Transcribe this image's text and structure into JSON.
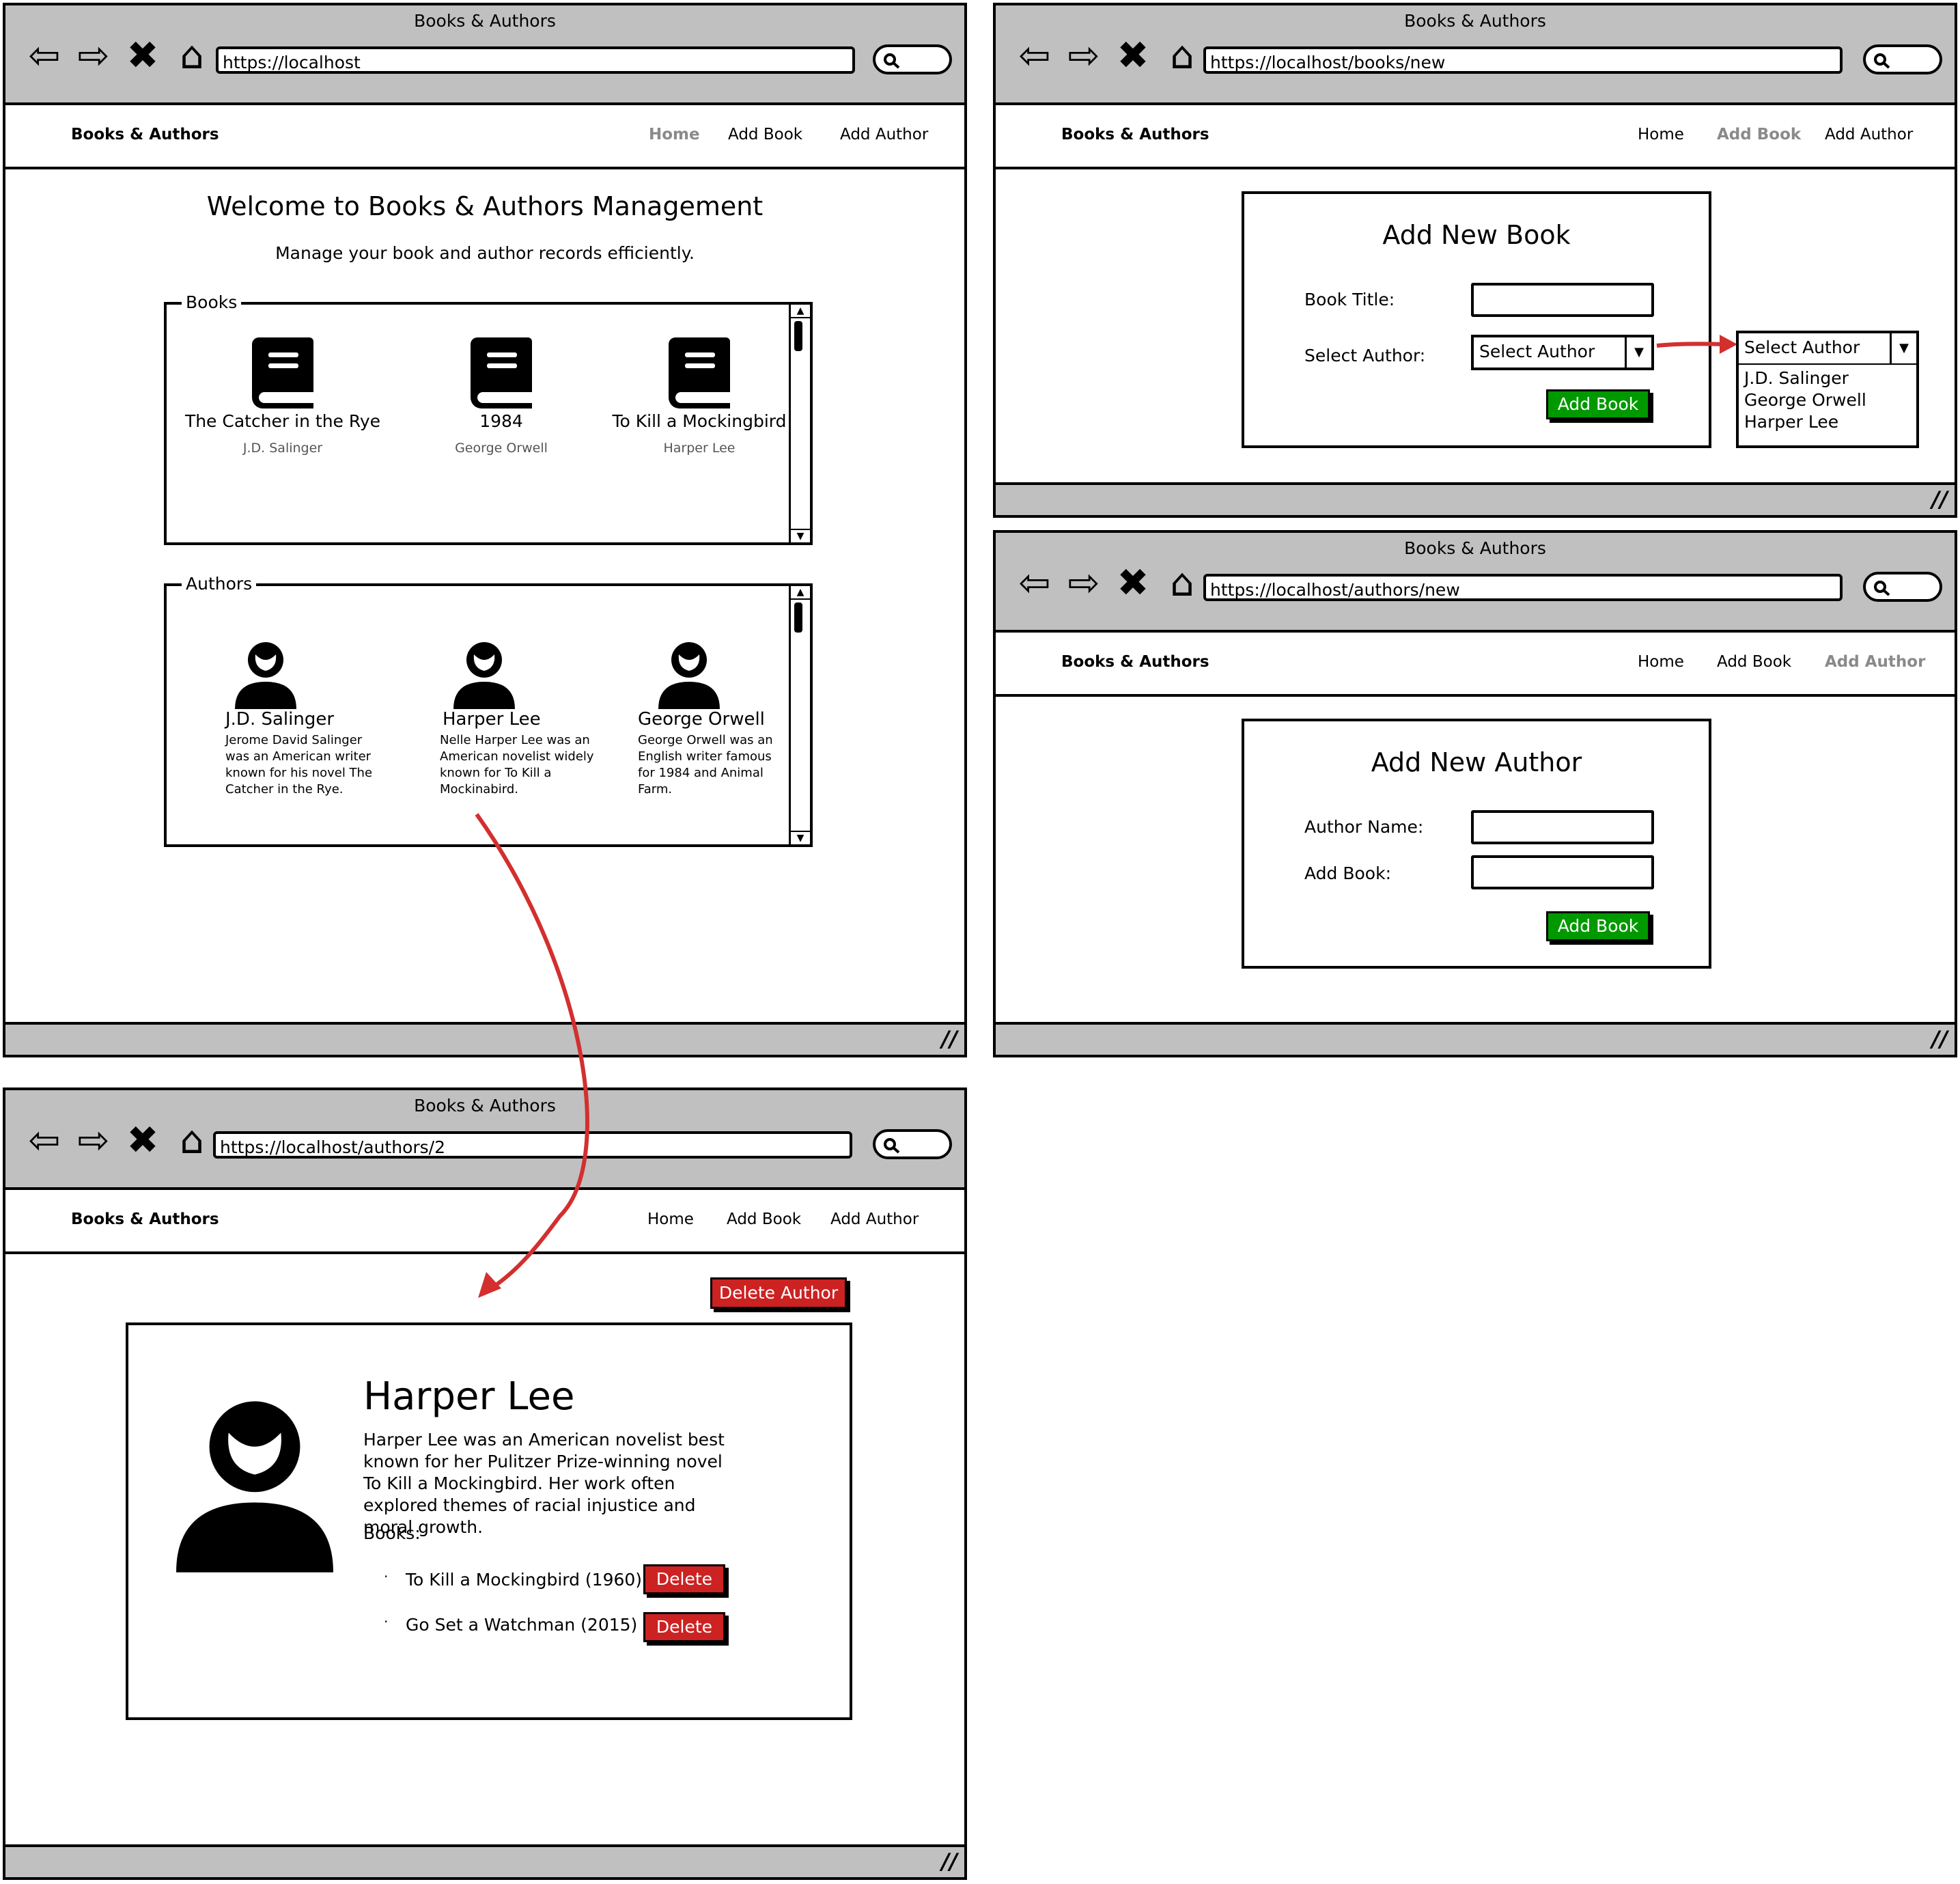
{
  "colors": {
    "chrome": "#c0c0c0",
    "accent_red": "#cc2222",
    "button_green": "#009900",
    "arrow_red": "#d32f2f"
  },
  "common": {
    "window_title": "Books & Authors",
    "brand": "Books & Authors",
    "nav": {
      "home": "Home",
      "add_book": "Add Book",
      "add_author": "Add Author"
    },
    "nav_icons": [
      "back-arrow-icon",
      "forward-arrow-icon",
      "close-icon",
      "home-icon"
    ],
    "search_icon": "search-icon"
  },
  "home": {
    "url": "https://localhost",
    "active_nav": "Home",
    "heading": "Welcome to Books & Authors Management",
    "subheading": "Manage your book and author records efficiently.",
    "books_label": "Books",
    "books": [
      {
        "title": "The Catcher in the Rye",
        "author": "J.D. Salinger",
        "icon": "book-icon"
      },
      {
        "title": "1984",
        "author": "George Orwell",
        "icon": "book-icon"
      },
      {
        "title": "To Kill a Mockingbird",
        "author": "Harper Lee",
        "icon": "book-icon"
      }
    ],
    "authors_label": "Authors",
    "authors": [
      {
        "name": "J.D. Salinger",
        "bio": "Jerome David Salinger was an American writer known for his novel The Catcher in the Rye.",
        "icon": "person-icon"
      },
      {
        "name": "Harper Lee",
        "bio": "Nelle Harper Lee was an American novelist widely known for To Kill a Mockinabird.",
        "icon": "person-icon"
      },
      {
        "name": "George Orwell",
        "bio": "George Orwell was an English writer famous for 1984 and Animal Farm.",
        "icon": "person-icon"
      }
    ]
  },
  "add_book": {
    "url": "https://localhost/books/new",
    "active_nav": "Add Book",
    "heading": "Add New Book",
    "title_label": "Book Title:",
    "author_label": "Select Author:",
    "select_value": "Select Author",
    "submit": "Add Book",
    "dropdown": {
      "value": "Select Author",
      "options": [
        "J.D. Salinger",
        "George Orwell",
        "Harper Lee"
      ]
    }
  },
  "add_author": {
    "url": "https://localhost/authors/new",
    "active_nav": "Add Author",
    "heading": "Add New Author",
    "name_label": "Author Name:",
    "book_label": "Add Book:",
    "submit": "Add Book"
  },
  "author_detail": {
    "url": "https://localhost/authors/2",
    "delete_author": "Delete Author",
    "name": "Harper Lee",
    "bio": "Harper Lee was an American novelist best known for her Pulitzer Prize-winning novel To Kill a Mockingbird. Her work often explored themes of racial injustice and moral growth.",
    "books_label": "Books:",
    "books": [
      {
        "title": "To Kill a Mockingbird (1960)",
        "action": "Delete"
      },
      {
        "title": "Go Set a Watchman (2015)",
        "action": "Delete"
      }
    ],
    "avatar_icon": "person-icon"
  }
}
